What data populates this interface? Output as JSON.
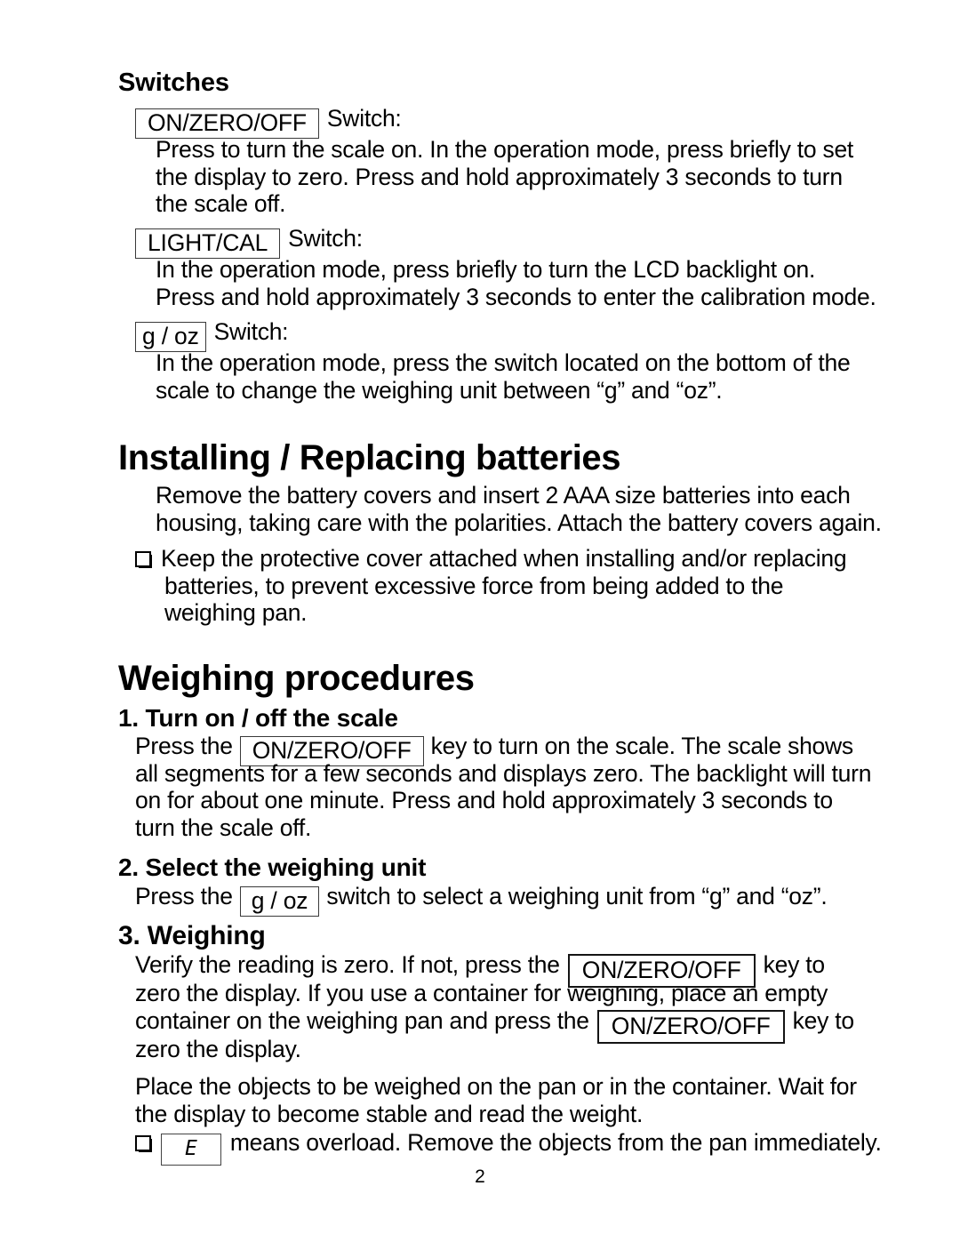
{
  "document": {
    "page_number": "2",
    "sections": {
      "switches": {
        "heading": "Switches",
        "entries": [
          {
            "key_label": "ON/ZERO/OFF",
            "suffix": "Switch:",
            "body_lines": [
              "Press to turn the scale on. In the operation mode, press briefly to set",
              "the display to zero. Press and hold approximately 3 seconds to turn",
              "the scale off."
            ]
          },
          {
            "key_label": "LIGHT/CAL",
            "suffix": "Switch:",
            "body_lines": [
              "In the operation mode, press briefly to turn the LCD backlight on.",
              "Press and hold approximately 3 seconds to enter the calibration mode."
            ]
          },
          {
            "key_label": "g / oz",
            "suffix": "Switch:",
            "body_lines": [
              "In the operation mode, press the switch located on the bottom of the",
              "scale to change the weighing unit between “g” and “oz”."
            ]
          }
        ]
      },
      "batteries": {
        "heading": "Installing / Replacing batteries",
        "paragraph_lines": [
          "Remove the battery covers and insert 2 AAA size batteries into each",
          "housing, taking care with the polarities. Attach the battery covers again."
        ],
        "bullet": {
          "lines": [
            "Keep the protective cover attached when installing and/or replacing",
            "batteries, to prevent excessive force from being added to the",
            "weighing pan."
          ]
        }
      },
      "weighing": {
        "heading": "Weighing procedures",
        "step1": {
          "heading": "1. Turn on / off the scale",
          "line1_before": "Press the",
          "line1_key": "ON/ZERO/OFF",
          "line1_after": "key to turn on the scale. The scale shows",
          "lines_rest": [
            "all segments for a few seconds and displays zero. The backlight will turn",
            "on for about one minute. Press and hold approximately 3 seconds to",
            "turn the scale off."
          ]
        },
        "step2": {
          "heading": "2. Select the weighing unit",
          "line1_before": "Press the",
          "line1_key": "g / oz",
          "line1_after": "switch to select a weighing unit from “g” and “oz”."
        },
        "step3": {
          "heading": "3. Weighing",
          "line1_before": "Verify the reading is zero. If not, press the",
          "line1_key": "ON/ZERO/OFF",
          "line1_after": "key to",
          "line2": "zero the display. If you use a container for weighing, place an empty",
          "line3_before": "container on the weighing pan and press the",
          "line3_key": "ON/ZERO/OFF",
          "line3_after": "key to",
          "line4": "zero the display.",
          "paragraph_lines": [
            "Place the objects to be weighed on the pan or in the container. Wait for",
            "the display to become stable and read the weight."
          ],
          "overload_bullet": {
            "display_value": "E",
            "text": "means overload. Remove the objects from the pan immediately."
          }
        }
      }
    }
  }
}
